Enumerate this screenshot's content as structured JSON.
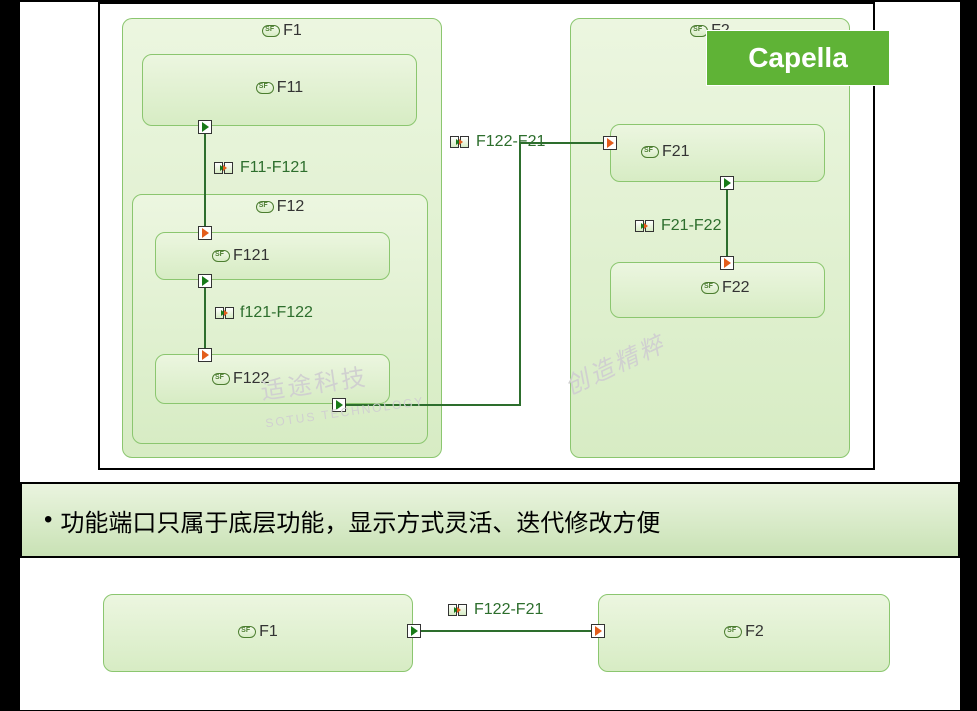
{
  "badge": "Capella",
  "functions": {
    "f1": {
      "label": "F1"
    },
    "f11": {
      "label": "F11"
    },
    "f12": {
      "label": "F12"
    },
    "f121": {
      "label": "F121"
    },
    "f122": {
      "label": "F122"
    },
    "f2": {
      "label": "F2"
    },
    "f21": {
      "label": "F21"
    },
    "f22": {
      "label": "F22"
    }
  },
  "exchanges": {
    "e1": {
      "label": "F11-F121"
    },
    "e2": {
      "label": "f121-F122"
    },
    "e3": {
      "label": "F122-F21"
    },
    "e4": {
      "label": "F21-F22"
    }
  },
  "textbar": "功能端口只属于底层功能，显示方式灵活、迭代修改方便",
  "bottom": {
    "f1": "F1",
    "f2": "F2",
    "ex": "F122-F21"
  },
  "watermark": "适途科技",
  "watermark2": "创造精粹",
  "watermark_sub": "SOTUS TECHNOLOGY"
}
